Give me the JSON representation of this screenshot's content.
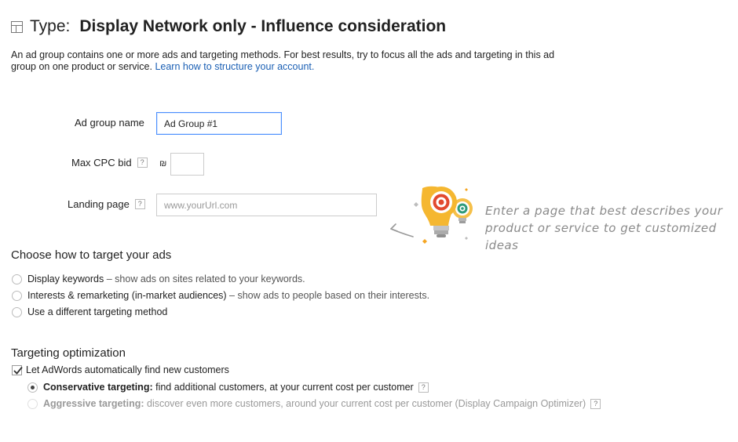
{
  "header": {
    "type_prefix": "Type:",
    "type_value": "Display Network only - Influence consideration",
    "icon": "layout-icon"
  },
  "description": {
    "text": "An ad group contains one or more ads and targeting methods. For best results, try to focus all the ads and targeting in this ad group on one product or service.",
    "link_text": "Learn how to structure your account."
  },
  "form": {
    "ad_group_name_label": "Ad group name",
    "ad_group_name_value": "Ad Group #1",
    "max_cpc_label": "Max CPC bid",
    "help_glyph": "?",
    "currency_symbol": "₪",
    "max_cpc_value": "",
    "landing_page_label": "Landing page",
    "landing_page_placeholder": "www.yourUrl.com",
    "landing_page_value": ""
  },
  "hint": {
    "line1": "Enter a page that best describes your",
    "line2": "product or service to get customized ideas",
    "icon": "lightbulb-target-icon",
    "arrow_icon": "curved-arrow-icon",
    "accent_color": "#f5a623",
    "target_color": "#e2492f"
  },
  "targeting": {
    "heading": "Choose how to target your ads",
    "options": [
      {
        "label": "Display keywords",
        "desc": " – show ads on sites related to your keywords.",
        "checked": false
      },
      {
        "label": "Interests & remarketing (in-market audiences)",
        "desc": " – show ads to people based on their interests.",
        "checked": false
      },
      {
        "label": "Use a different targeting method",
        "desc": "",
        "checked": false
      }
    ]
  },
  "optimization": {
    "heading": "Targeting optimization",
    "checkbox_label": "Let AdWords automatically find new customers",
    "checkbox_checked": true,
    "conservative_bold": "Conservative targeting:",
    "conservative_desc": " find additional customers, at your current cost per customer",
    "aggressive_bold": "Aggressive targeting:",
    "aggressive_desc": " discover even more customers, around your current cost per customer (Display Campaign Optimizer)",
    "selected": "conservative"
  },
  "colors": {
    "link": "#1a5fb4",
    "focus_border": "#4d90fe"
  }
}
